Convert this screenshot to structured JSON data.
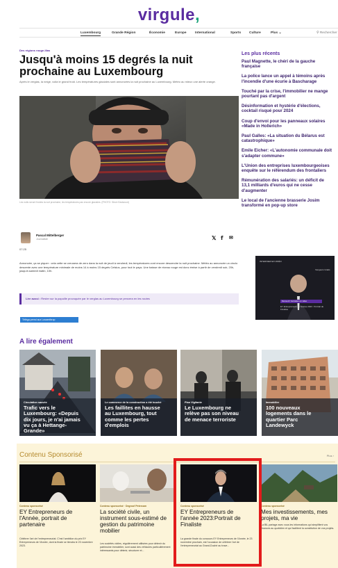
{
  "site": {
    "logo": "virgule",
    "logo_dot": ","
  },
  "nav": {
    "items": [
      "Luxembourg",
      "Grande Région",
      "Économie",
      "Europe",
      "International",
      "Sports",
      "Culture",
      "Plus ⌄"
    ],
    "right": "⚲ Rechercher"
  },
  "article": {
    "kicker": "Des régions rouge-lilas",
    "title": "Jusqu'à moins 15 degrés la nuit prochaine au Luxembourg",
    "lead": "Après le verglas, la neige, voilà le grand froid. Les températures glaciales sont annoncées la nuit prochaine au Luxembourg. Météo au mieux une alerte orange.",
    "caption": "Les nuits seront froides la nuit prochaine, les températures pas encore glaciales. (PHOTO: Steve Eastwood)",
    "author": {
      "name": "Pascal Mittelberger",
      "role": "Journaliste"
    },
    "time": "07:25",
    "share_icons": [
      "twitter-icon",
      "facebook-icon",
      "email-icon"
    ],
    "body": "Annoncée, ça se piquer : cela cette se creusera de zero dans la nuit de jeudi à vendredi, les températures vont encore descendre la nuit prochaine. Météo au annoncée un cinclo descente avec une température minimale de moins 14 à moins 15 degrés Celsius, pour tout le pays. Une baisse de niveau rouge est donc émise à partir de vendredi soir, 20h, jusqu'à samedi matin, 10h.",
    "read_also_label": "Lire aussi :",
    "read_also_text": "Rester sur la papuille provoquée par le verglas au Luxembourg se pencera en les routes",
    "follow_button": "Téléga prend aux Lossenthrop"
  },
  "sidebar": {
    "title": "Les plus récents",
    "items": [
      "Paul Magnette, le chéri de la gauche\nfrançaise",
      "La police lance un appel à témoins après\nl'incendie d'une écurie à Bascharage",
      "Touché par la crise, l'immobilier ne mange\npourtant pas d'argent",
      "Désinformation et hystérie d'élections,\ncocktail risqué pour 2024",
      "Coup d'envoi pour les panneaux solaires\n«Made in Hollerich»",
      "Paul Galles: «La situation du Bélarus est\ncatastrophique»",
      "Émile Eicher: «L'autonomie communale doit\ns'adapter commune»",
      "L'Union des entreprises luxembourgeoises\nenquête sur le référendum des frontaliers",
      "Rémunération des salariés: un déficit de\n13,1 milliards d'euros qui ne cesse\nd'augmenter",
      "Le local de l'ancienne brasserie Josim\ntransformé en pop-up store"
    ]
  },
  "video": {
    "tag": "INTERVIEW EN VIDÉO",
    "label": "Vengeurs Gratis",
    "badge": "Découvrir l'entretien en vidéo",
    "title": "EY Entrepreneurs de l'année 2023 : Portrait de Finaliste"
  },
  "read_more": {
    "title": "A lire également",
    "cards": [
      {
        "kicker": "Circulation sauvée",
        "title": "Trafic vers le\nLuxembourg: «Depuis\ndix jours, je n'ai jamais\nvu ça à Hettange-\nGrande»"
      },
      {
        "kicker": "Le commerce de la construction a été touché",
        "title": "Les faillites en hausse\nau Luxembourg, tout\ncomme les pertes\nd'emplois"
      },
      {
        "kicker": "Plan Vigilante",
        "title": "Le Luxembourg ne\nrelève pas son niveau\nde menace terroriste"
      },
      {
        "kicker": "Immobilier",
        "title": "100 nouveaux\nlogements dans le\nquartier Parc\nLandewyck"
      }
    ]
  },
  "sponsored": {
    "title": "Contenu Sponsorisé",
    "more": "Plus ›",
    "cards": [
      {
        "label": "Contenu sponsorisé",
        "title": "EY Entrepreneurs de\nl'Année, portrait de\npartenaire",
        "excerpt": "Célébrer l'art de l'entrepreneuriat. C'est l'ambition du prix EY Entrepreneurs de l'Année, dont la finale se tiendra le 23 novembre 2023."
      },
      {
        "label": "Contenu sponsorisé · Degroof Petercam",
        "title": "La société civile, un\ninstrument sous-estimé de\ngestion du patrimoine\nmobilier",
        "excerpt": "Les sociétés civiles, régulièrement utilisées pour détenir du patrimoine immobilier, sont aussi des véhicules particulièrement intéressants pour détenir, structurer et..."
      },
      {
        "label": "Contenu sponsorisé",
        "title": "EY Entrepreneurs de\nl'année 2023:Portrait de\nFinaliste",
        "excerpt": "La grande finale du concours EY Entrepreneurs de l'Année, le 23 novembre prochain, est l'occasion de célébrer l'art de l'entrepreneuriat au Grand-Duché au trave..."
      },
      {
        "label": "Contenu sponsorisé",
        "title": "Mes investissements, mes\nprojets, ma vie",
        "excerpt": "La BIL partage avec vous les informations qui simplifient vos finances au quotidien et qui facilitent la constitution de vos projets."
      }
    ]
  },
  "colors": {
    "brand": "#5a2ca0",
    "accent": "#1aa37a",
    "sponsored_bg": "#fcf4d9",
    "highlight": "#e21b1b"
  }
}
